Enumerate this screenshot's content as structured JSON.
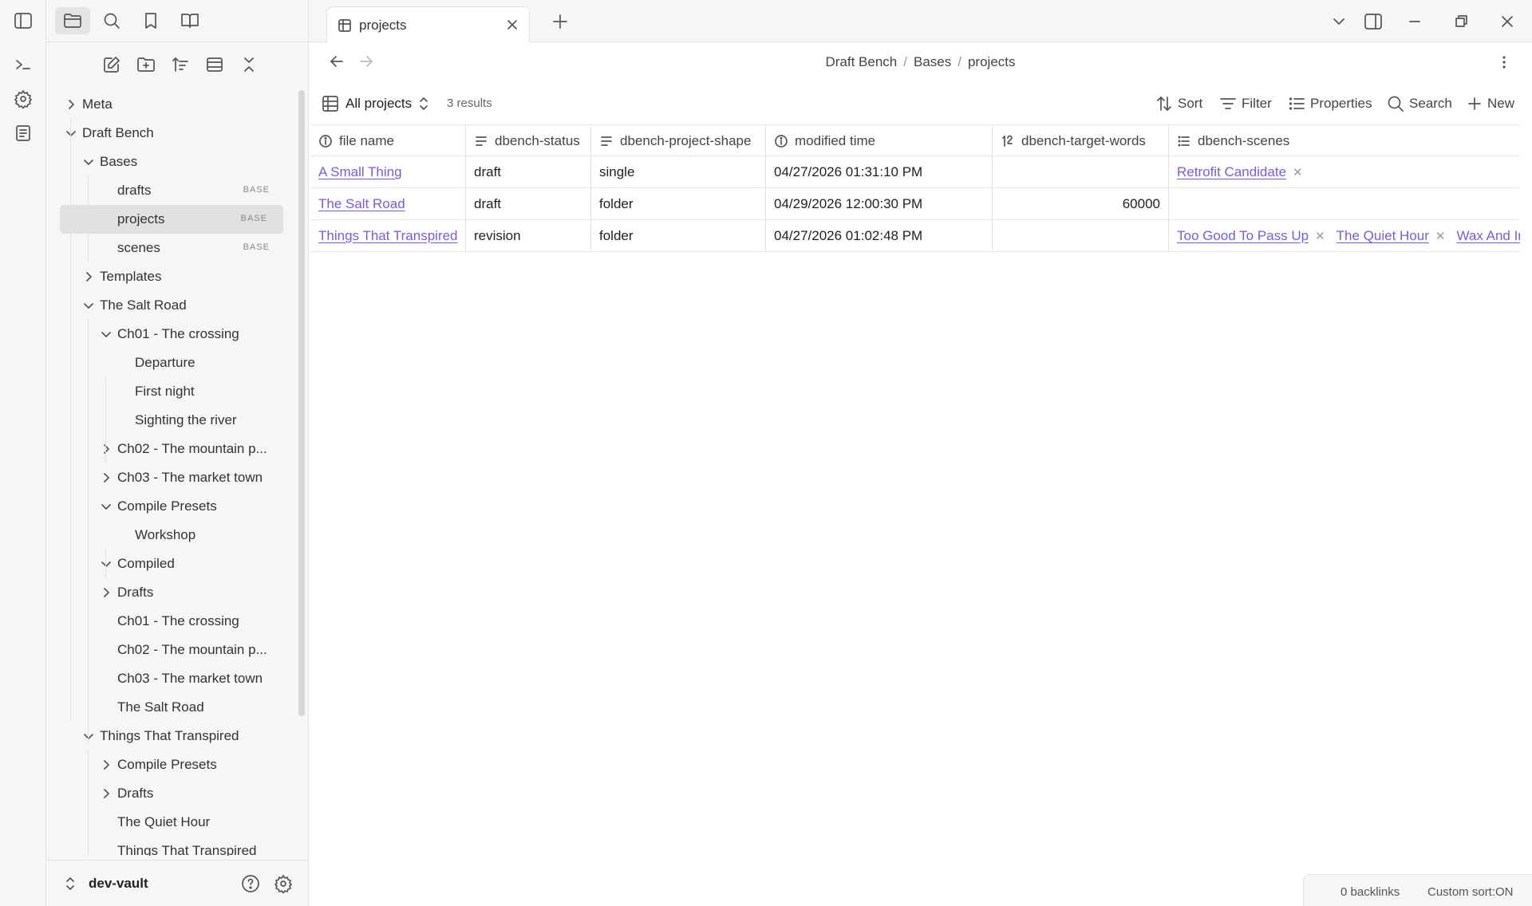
{
  "ribbon": {
    "icons": [
      "sidebar-toggle-icon",
      "terminal-icon",
      "settings-icon",
      "templates-icon"
    ]
  },
  "sidebar": {
    "tabs": [
      "files-icon",
      "search-icon",
      "bookmark-icon",
      "book-icon"
    ],
    "actions": [
      "new-note-icon",
      "new-folder-icon",
      "sort-icon",
      "collapse-icon",
      "close-icon"
    ],
    "tree": [
      {
        "label": "Meta",
        "depth": 0,
        "chevron": "right"
      },
      {
        "label": "Draft Bench",
        "depth": 0,
        "chevron": "down"
      },
      {
        "label": "Bases",
        "depth": 1,
        "chevron": "down"
      },
      {
        "label": "drafts",
        "depth": 2,
        "badge": "BASE"
      },
      {
        "label": "projects",
        "depth": 2,
        "badge": "BASE",
        "selected": true
      },
      {
        "label": "scenes",
        "depth": 2,
        "badge": "BASE"
      },
      {
        "label": "Templates",
        "depth": 1,
        "chevron": "right"
      },
      {
        "label": "The Salt Road",
        "depth": 1,
        "chevron": "down"
      },
      {
        "label": "Ch01 - The crossing",
        "depth": 2,
        "chevron": "down"
      },
      {
        "label": "Departure",
        "depth": 3
      },
      {
        "label": "First night",
        "depth": 3
      },
      {
        "label": "Sighting the river",
        "depth": 3
      },
      {
        "label": "Ch02 - The mountain p...",
        "depth": 2,
        "chevron": "right"
      },
      {
        "label": "Ch03 - The market town",
        "depth": 2,
        "chevron": "right"
      },
      {
        "label": "Compile Presets",
        "depth": 2,
        "chevron": "down"
      },
      {
        "label": "Workshop",
        "depth": 3
      },
      {
        "label": "Compiled",
        "depth": 2,
        "chevron": "down"
      },
      {
        "label": "Drafts",
        "depth": 2,
        "chevron": "right"
      },
      {
        "label": "Ch01 - The crossing",
        "depth": 2
      },
      {
        "label": "Ch02 - The mountain p...",
        "depth": 2
      },
      {
        "label": "Ch03 - The market town",
        "depth": 2
      },
      {
        "label": "The Salt Road",
        "depth": 2
      },
      {
        "label": "Things That Transpired",
        "depth": 1,
        "chevron": "down"
      },
      {
        "label": "Compile Presets",
        "depth": 2,
        "chevron": "right"
      },
      {
        "label": "Drafts",
        "depth": 2,
        "chevron": "right"
      },
      {
        "label": "The Quiet Hour",
        "depth": 2
      },
      {
        "label": "Things That Transpired",
        "depth": 2
      }
    ],
    "vault_name": "dev-vault"
  },
  "tabbar": {
    "tab_title": "projects"
  },
  "breadcrumb": [
    "Draft Bench",
    "Bases",
    "projects"
  ],
  "toolbar": {
    "view_name": "All projects",
    "results": "3 results",
    "sort": "Sort",
    "filter": "Filter",
    "properties": "Properties",
    "search": "Search",
    "new": "New"
  },
  "table": {
    "columns": [
      {
        "label": "file name",
        "icon": "info-icon"
      },
      {
        "label": "dbench-status",
        "icon": "text-lines-icon"
      },
      {
        "label": "dbench-project-shape",
        "icon": "text-lines-icon"
      },
      {
        "label": "modified time",
        "icon": "info-icon"
      },
      {
        "label": "dbench-target-words",
        "icon": "number-icon"
      },
      {
        "label": "dbench-scenes",
        "icon": "list-icon"
      }
    ],
    "rows": [
      {
        "file": "A Small Thing",
        "status": "draft",
        "shape": "single",
        "modified": "04/27/2026 01:31:10 PM",
        "target": "",
        "scenes": [
          "Retrofit Candidate"
        ]
      },
      {
        "file": "The Salt Road",
        "status": "draft",
        "shape": "folder",
        "modified": "04/29/2026 12:00:30 PM",
        "target": "60000",
        "scenes": []
      },
      {
        "file": "Things That Transpired",
        "status": "revision",
        "shape": "folder",
        "modified": "04/27/2026 01:02:48 PM",
        "target": "",
        "scenes": [
          "Too Good To Pass Up",
          "The Quiet Hour",
          "Wax And Ir"
        ]
      }
    ]
  },
  "statusbar": {
    "backlinks": "0 backlinks",
    "custom_sort": "Custom sort:ON"
  },
  "colors": {
    "link": "#7b5cd6",
    "sidebar_bg": "#f6f6f6",
    "border": "#e3e3e3"
  }
}
